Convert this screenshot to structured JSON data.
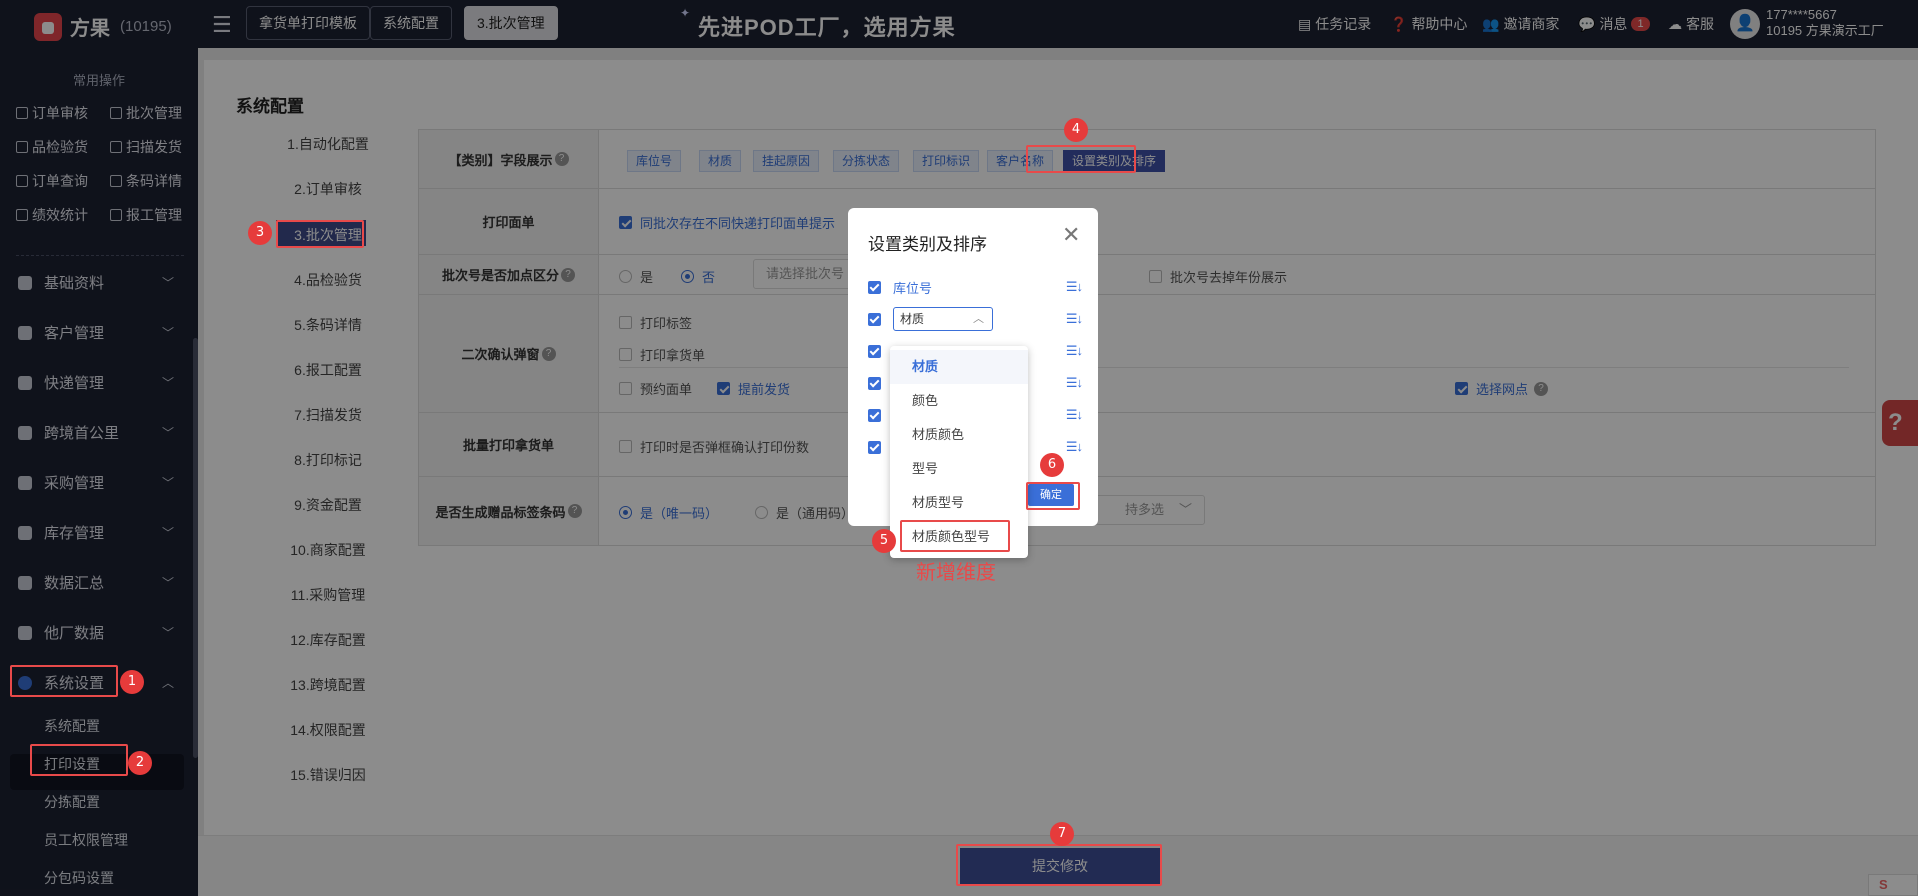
{
  "header": {
    "logo_text": "方果",
    "logo_code": "(10195)",
    "tabs": [
      "拿货单打印模板",
      "系统配置",
      "3.批次管理"
    ],
    "slogan": "先进POD工厂，选用方果",
    "links": [
      "任务记录",
      "帮助中心",
      "邀请商家",
      "消息",
      "客服"
    ],
    "message_count": "1",
    "user_phone": "177****5667",
    "user_org": "10195 方果演示工厂"
  },
  "sidebar": {
    "section_title": "常用操作",
    "quick_ops": [
      "订单审核",
      "批次管理",
      "品检验货",
      "扫描发货",
      "订单查询",
      "条码详情",
      "绩效统计",
      "报工管理"
    ],
    "nav": [
      "基础资料",
      "客户管理",
      "快递管理",
      "跨境首公里",
      "采购管理",
      "库存管理",
      "数据汇总",
      "他厂数据",
      "系统设置"
    ],
    "sub": [
      "系统配置",
      "打印设置",
      "分拣配置",
      "员工权限管理",
      "分包码设置"
    ]
  },
  "page": {
    "title": "系统配置",
    "left_nav": [
      "1.自动化配置",
      "2.订单审核",
      "3.批次管理",
      "4.品检验货",
      "5.条码详情",
      "6.报工配置",
      "7.扫描发货",
      "8.打印标记",
      "9.资金配置",
      "10.商家配置",
      "11.采购管理",
      "12.库存配置",
      "13.跨境配置",
      "14.权限配置",
      "15.错误归因"
    ],
    "rows": {
      "category_label": "【类别】字段展示",
      "category_chips": [
        "库位号",
        "材质",
        "挂起原因",
        "分拣状态",
        "打印标识",
        "客户名称",
        "设置类别及排序"
      ],
      "print_label": "打印面单",
      "print_option": "同批次存在不同快递打印面单提示",
      "batch_label": "批次号是否加点区分",
      "radio_yes": "是",
      "radio_no": "否",
      "batch_select_placeholder": "请选择批次号",
      "batch_year_option": "批次号去掉年份展示",
      "confirm_label": "二次确认弹窗",
      "confirm_opts": [
        "打印标签",
        "打印拿货单",
        "预约面单",
        "提前发货"
      ],
      "select_point": "选择网点",
      "bulk_label": "批量打印拿货单",
      "bulk_option": "打印时是否弹框确认打印份数",
      "gift_label": "是否生成赠品标签条码",
      "gift_yes": "是（唯一码）",
      "gift_generic": "是（通用码）",
      "gift_select_text": "持多选"
    },
    "submit": "提交修改"
  },
  "modal": {
    "title": "设置类别及排序",
    "first_item": "库位号",
    "select_value": "材质",
    "confirm": "确定",
    "options": [
      "材质",
      "颜色",
      "材质颜色",
      "型号",
      "材质型号",
      "材质颜色型号"
    ]
  },
  "annotation": {
    "new_dimension": "新增维度",
    "steps": [
      "1",
      "2",
      "3",
      "4",
      "5",
      "6",
      "7"
    ]
  },
  "colors": {
    "accent": "#3a6fd8",
    "highlight": "#e84a4a",
    "sidebar": "#1d2132"
  }
}
